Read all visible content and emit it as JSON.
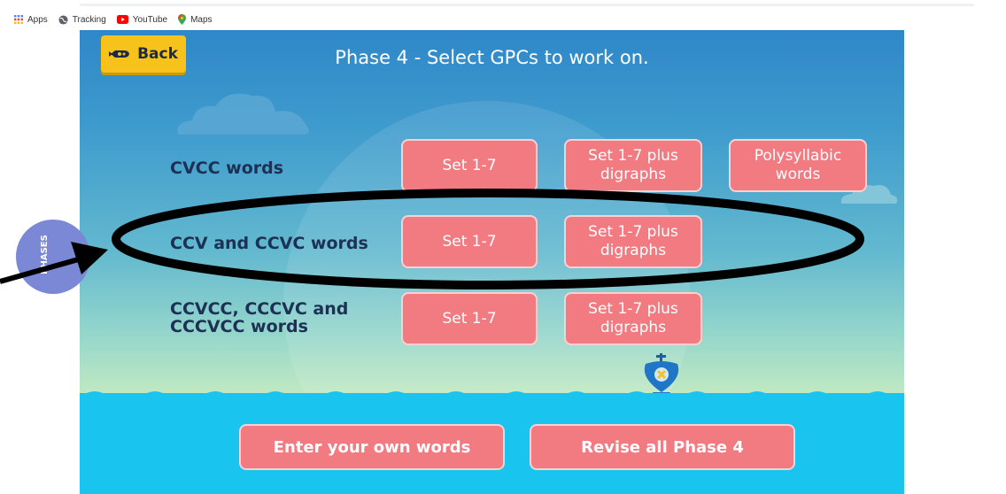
{
  "bookmarks": [
    {
      "label": "Apps",
      "icon": "apps-grid-icon"
    },
    {
      "label": "Tracking",
      "icon": "globe-icon"
    },
    {
      "label": "YouTube",
      "icon": "youtube-icon"
    },
    {
      "label": "Maps",
      "icon": "maps-pin-icon"
    }
  ],
  "game": {
    "back_label": "Back",
    "title": "Phase 4 - Select GPCs to work on.",
    "side_tab_label": "PHASES",
    "rows": [
      {
        "label": "CVCC words",
        "options": [
          "Set 1-7",
          "Set 1-7 plus digraphs",
          "Polysyllabic words"
        ]
      },
      {
        "label": "CCV and CCVC words",
        "options": [
          "Set 1-7",
          "Set 1-7 plus digraphs"
        ]
      },
      {
        "label": "CCVCC, CCCVC and CCCVCC words",
        "options": [
          "Set 1-7",
          "Set 1-7 plus digraphs"
        ]
      }
    ],
    "enter_own_label": "Enter your own words",
    "revise_label": "Revise all Phase 4"
  },
  "colors": {
    "button_fill": "#f27b82",
    "back_button": "#f6c21b",
    "water": "#19c4ee",
    "sky_top": "#2f87c8",
    "label_text": "#1c3153"
  }
}
